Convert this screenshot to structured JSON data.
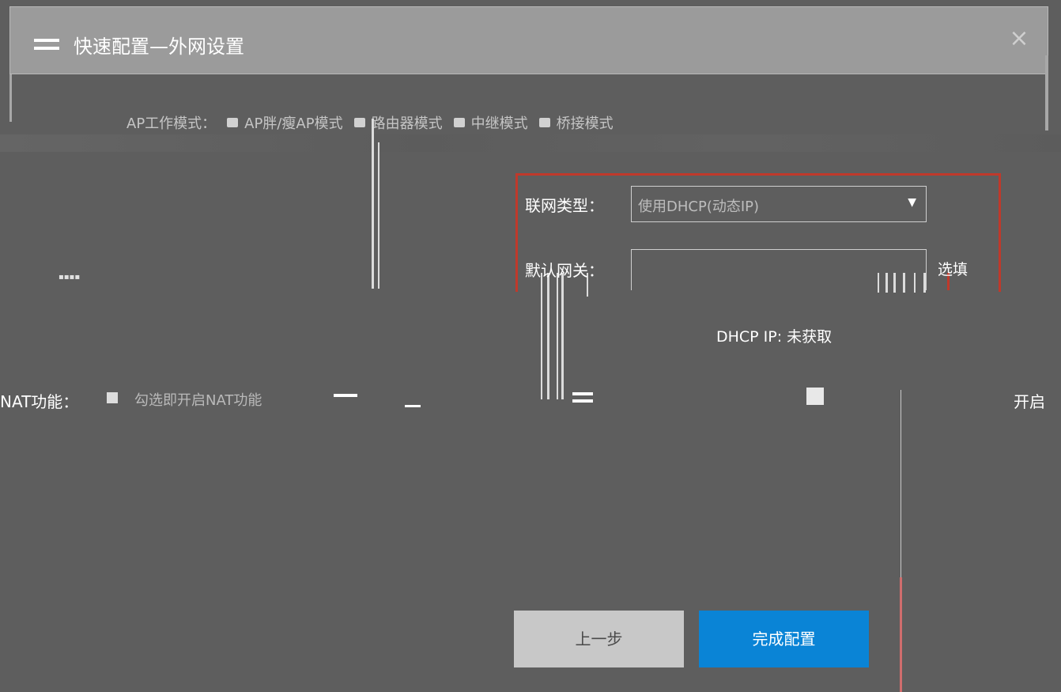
{
  "window": {
    "title": "快速配置—外网设置",
    "menu_icon": "menu-icon",
    "close_icon": "close-icon",
    "close_glyph": "×"
  },
  "mode_row": {
    "label": "AP工作模式：",
    "options": [
      {
        "label": "AP胖/瘦AP模式",
        "icon": "radio-icon"
      },
      {
        "label": "路由器模式",
        "icon": "radio-icon"
      },
      {
        "label": "中继模式",
        "icon": "radio-icon"
      },
      {
        "label": "桥接模式",
        "icon": "radio-icon"
      }
    ]
  },
  "wan": {
    "conn_type_label": "联网类型：",
    "conn_type_value": "使用DHCP(动态IP)",
    "conn_type_arrow": "▼",
    "gateway_label": "默认网关：",
    "gateway_optional": "选填",
    "dhcp_ip_label": "DHCP IP: 未获取"
  },
  "nat": {
    "label": "NAT功能：",
    "description": "勾选即开启NAT功能",
    "enable_label": "开启"
  },
  "buttons": {
    "prev": "上一步",
    "finish": "完成配置"
  },
  "colors": {
    "title_bar": "#9b9b9b",
    "background": "#5e5e5e",
    "highlight_border": "#c0392b",
    "primary_button": "#0a84d6",
    "secondary_button": "#c8c8c8"
  }
}
